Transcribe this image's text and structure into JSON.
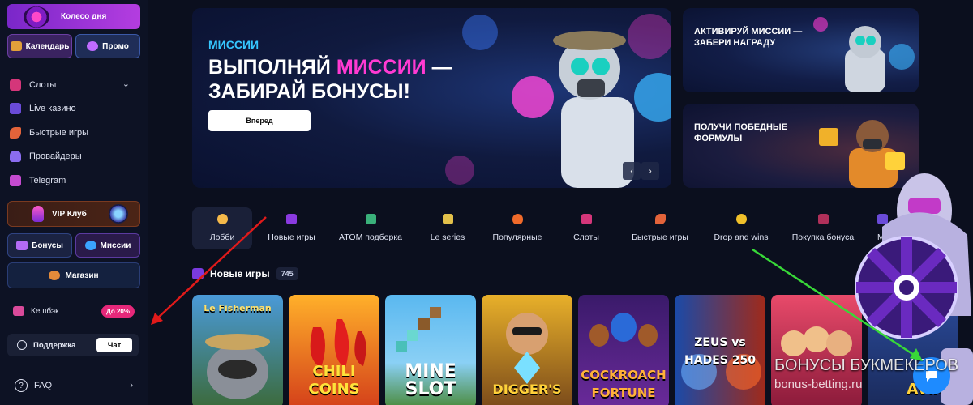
{
  "sidebar": {
    "wheel_label": "Колесо дня",
    "calendar_label": "Календарь",
    "promo_label": "Промо",
    "nav": [
      {
        "label": "Слоты",
        "icon": "slot-icon"
      },
      {
        "label": "Live казино",
        "icon": "live-casino-icon"
      },
      {
        "label": "Быстрые игры",
        "icon": "rocket-icon"
      },
      {
        "label": "Провайдеры",
        "icon": "providers-icon"
      },
      {
        "label": "Telegram",
        "icon": "telegram-icon"
      }
    ],
    "vip_label": "VIP Клуб",
    "bonus_label": "Бонусы",
    "missions_label": "Миссии",
    "shop_label": "Магазин",
    "cashback_label": "Кешбэк",
    "cashback_badge": "До 20%",
    "support_label": "Поддержка",
    "chat_label": "Чат",
    "faq_label": "FAQ"
  },
  "hero": {
    "kicker": "МИССИИ",
    "title_part1": "ВЫПОЛНЯЙ ",
    "title_highlight": "МИССИИ",
    "title_part2": " — ЗАБИРАЙ БОНУСЫ!",
    "cta_label": "Вперед",
    "prev": "‹",
    "next": "›"
  },
  "side_cards": [
    {
      "title": "АКТИВИРУЙ МИССИИ — ЗАБЕРИ НАГРАДУ"
    },
    {
      "title": "ПОЛУЧИ ПОБЕДНЫЕ ФОРМУЛЫ"
    }
  ],
  "tabs": [
    {
      "label": "Лобби",
      "active": true
    },
    {
      "label": "Новые игры"
    },
    {
      "label": "ATOM подборка"
    },
    {
      "label": "Le series"
    },
    {
      "label": "Популярные"
    },
    {
      "label": "Слоты"
    },
    {
      "label": "Быстрые игры"
    },
    {
      "label": "Drop and wins"
    },
    {
      "label": "Покупка бонуса"
    },
    {
      "label": "Мега"
    }
  ],
  "new_games": {
    "title": "Новые игры",
    "count": "745",
    "cards": [
      {
        "title": "Le Fisherman"
      },
      {
        "title": "CHILI COINS"
      },
      {
        "title": "MINE SLOT"
      },
      {
        "title": "DIGGER'S"
      },
      {
        "title": "COCKROACH FORTUNE"
      },
      {
        "title": "ZEUS vs HADES 250"
      },
      {
        "title": ""
      },
      {
        "title": "AVIAF"
      }
    ]
  },
  "watermark": {
    "line1": "БОНУСЫ БУКМЕКЕРОВ",
    "line2": "bonus-betting.ru"
  },
  "colors": {
    "accent_pink": "#ff3ad2",
    "accent_blue": "#36c7ff",
    "badge_pink": "#e6287a"
  }
}
